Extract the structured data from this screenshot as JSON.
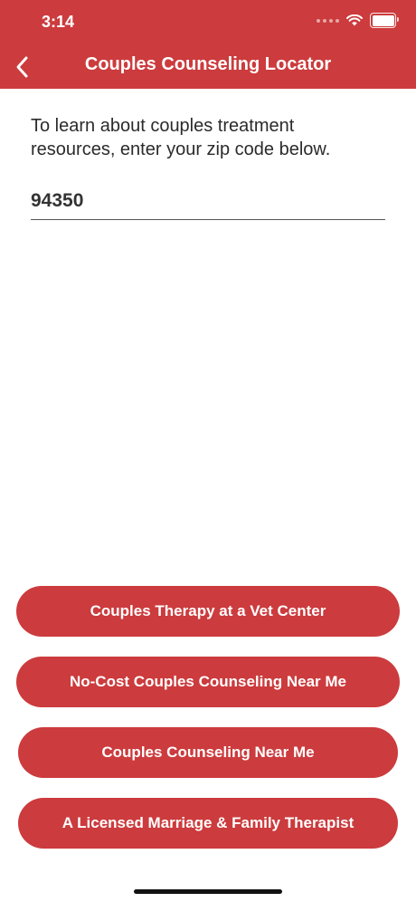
{
  "status_bar": {
    "time": "3:14"
  },
  "nav": {
    "title": "Couples Counseling Locator",
    "back_icon": "chevron-left-icon"
  },
  "form": {
    "instructions": "To learn about couples treatment resources, enter your zip code below.",
    "zip_value": "94350"
  },
  "buttons": [
    {
      "label": "Couples Therapy at a Vet Center"
    },
    {
      "label": "No-Cost Couples Counseling Near Me"
    },
    {
      "label": "Couples Counseling Near Me"
    },
    {
      "label": "A Licensed Marriage & Family Therapist"
    }
  ],
  "colors": {
    "accent": "#cc3b3d",
    "background": "#ffffff",
    "text": "#2b2b2b"
  }
}
